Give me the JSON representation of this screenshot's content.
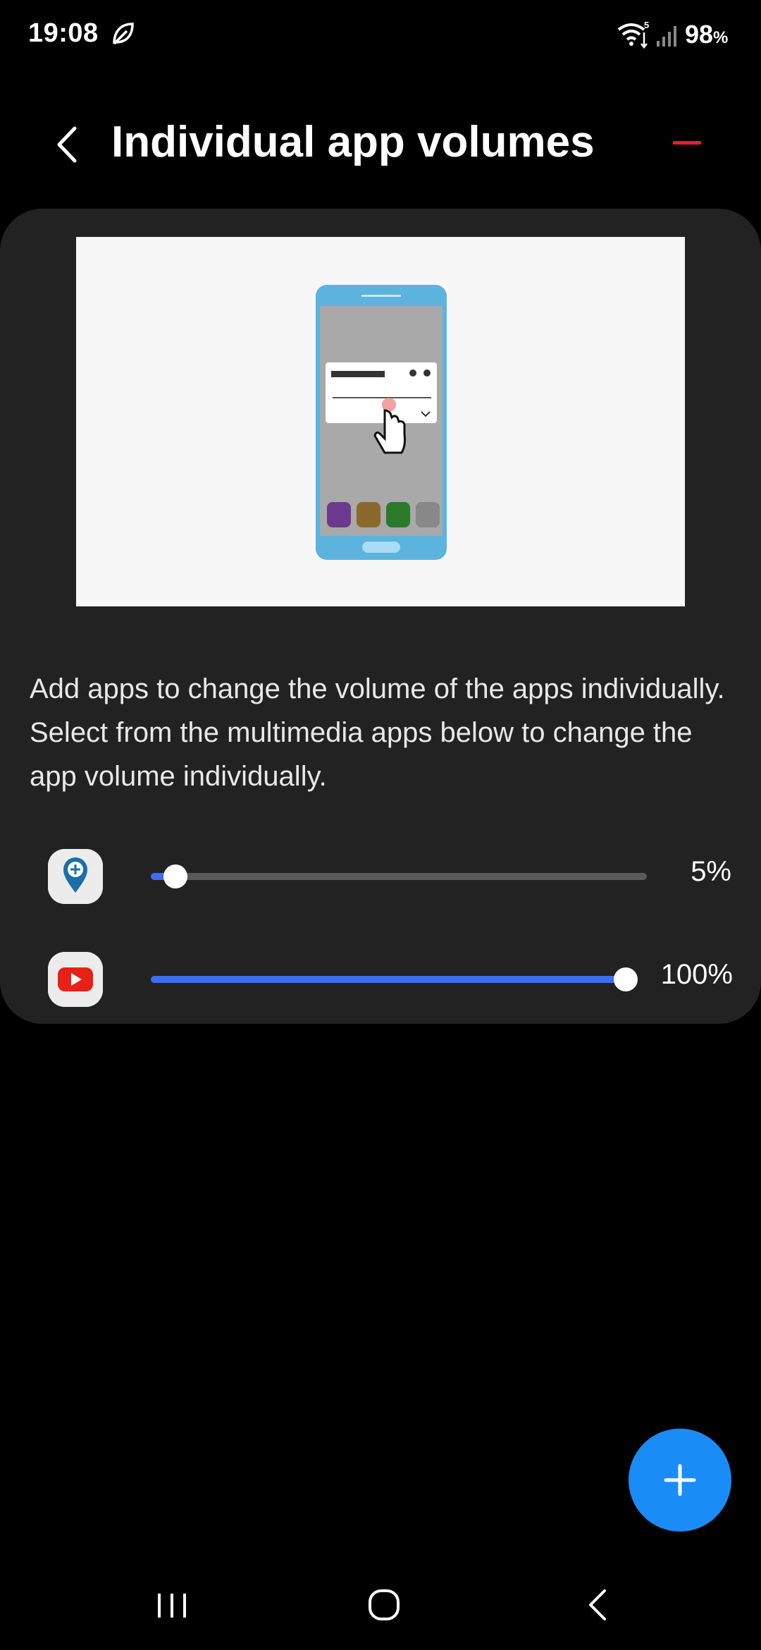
{
  "status_bar": {
    "time": "19:08",
    "battery_value": "98",
    "battery_unit": "%",
    "icons": [
      "leaf-icon",
      "wifi-icon",
      "signal-icon"
    ]
  },
  "header": {
    "title": "Individual app volumes",
    "back_icon": "chevron-left-icon",
    "remove_icon": "minus-icon"
  },
  "card": {
    "description": "Add apps to change the volume of the apps individually. Select from the multimedia apps below to change the app volume individually.",
    "apps": [
      {
        "icon": "map-pin-plus-icon",
        "volume_label": "5%",
        "volume_fraction": 0.05
      },
      {
        "icon": "youtube-icon",
        "volume_label": "100%",
        "volume_fraction": 1.0
      }
    ]
  },
  "fab": {
    "icon": "plus-icon"
  },
  "nav_bar": {
    "icons": [
      "recents-icon",
      "home-icon",
      "back-icon"
    ]
  },
  "colors": {
    "background": "#000000",
    "card": "#222222",
    "accent": "#3e6df0",
    "fab": "#1a8cf6",
    "remove": "#e0202f"
  }
}
